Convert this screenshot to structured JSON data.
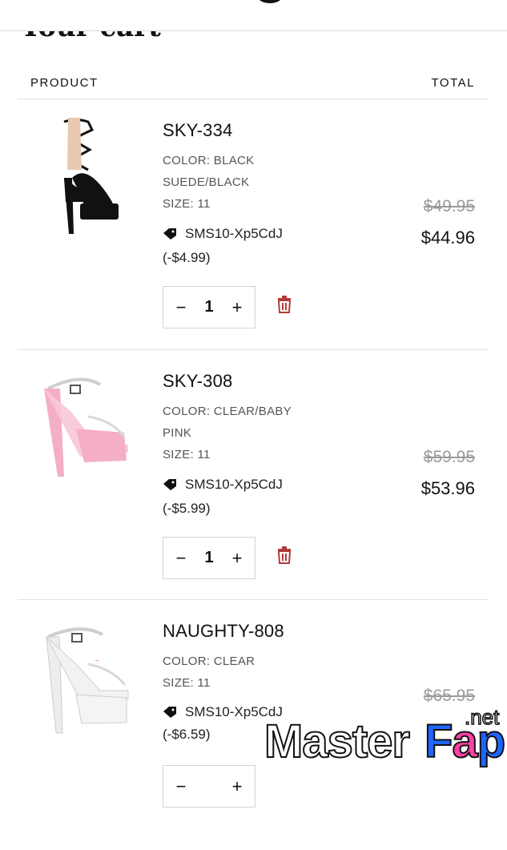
{
  "header": {
    "page_title": "Your cart"
  },
  "columns": {
    "product": "PRODUCT",
    "total": "TOTAL"
  },
  "items": [
    {
      "name": "SKY-334",
      "meta": [
        "COLOR: BLACK",
        "SUEDE/BLACK",
        "SIZE: 11"
      ],
      "discount_code": "SMS10-Xp5CdJ",
      "discount_amount": "(-$4.99)",
      "price_original": "$49.95",
      "price_final": "$44.96",
      "quantity": "1",
      "colors": {
        "shoe": "#111111"
      }
    },
    {
      "name": "SKY-308",
      "meta": [
        "COLOR: CLEAR/BABY",
        "PINK",
        "SIZE: 11"
      ],
      "discount_code": "SMS10-Xp5CdJ",
      "discount_amount": "(-$5.99)",
      "price_original": "$59.95",
      "price_final": "$53.96",
      "quantity": "1",
      "colors": {
        "shoe": "#f4aec6"
      }
    },
    {
      "name": "NAUGHTY-808",
      "meta": [
        "COLOR: CLEAR",
        "SIZE: 11"
      ],
      "discount_code": "SMS10-Xp5CdJ",
      "discount_amount": "(-$6.59)",
      "price_original": "$65.95",
      "price_final": "",
      "quantity": "",
      "colors": {
        "shoe": "#e6e6e6"
      }
    }
  ],
  "icons": {
    "minus": "minus-icon",
    "plus": "plus-icon",
    "trash": "trash-icon",
    "tag": "tag-icon"
  },
  "colors": {
    "trash": "#b23a3a",
    "divider": "#e2e2e2",
    "strike_price": "#9a9a9a"
  },
  "watermark": {
    "part1": "Master",
    "part2_f": "F",
    "part2_a": "a",
    "part2_p": "p",
    "suffix": ".net"
  }
}
